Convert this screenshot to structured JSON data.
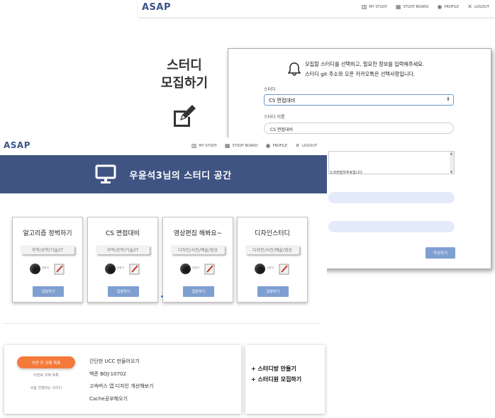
{
  "brand": "ASAP",
  "nav": {
    "my_study": "MY STUDY",
    "study_board": "STUDY BOARD",
    "profile": "PROFILE",
    "logout": "LOGOUT"
  },
  "recruit": {
    "title": "스터디\n모집하기",
    "message_line1": "모집할 스터디를 선택하고, 필요한 정보를 입력해주세요.",
    "message_line2": "스터디 git 주소와 오픈 카카오톡은 선택사항입니다.",
    "study_label": "스터디",
    "study_selected": "CS 면접대비",
    "name_label": "스터디 이름",
    "name_value": "CS 면접대비",
    "textarea_snippet": "드와면접위주로합니다",
    "submit_label": "작성하기"
  },
  "banner": {
    "title": "우윤석3님의 스터디 공간"
  },
  "studies": [
    {
      "name": "알고리즘 정벅하기",
      "tags": "과학/공학/기술/IT",
      "join_label": "입장하기"
    },
    {
      "name": "CS 면접대비",
      "tags": "과학/공학/기술/IT",
      "join_label": "입장하기"
    },
    {
      "name": "영상편집 해봐요~",
      "tags": "디자인/사진/예술/영상",
      "join_label": "입장하기"
    },
    {
      "name": "디자인스터디",
      "tags": "디자인/사진/예술/영상",
      "join_label": "입장하기"
    }
  ],
  "avatar_caption": "우윤석",
  "tasks_panel": {
    "tab_active": "이번 주 과제 목록",
    "tab_2": "이번로 과제 목록",
    "tab_3": "오늘 진행되는 스터디",
    "items": [
      "간단한 UCC 만들어오기",
      "백준 BOJ-10702",
      "고속버스 앱 디자인 개선해보기",
      "Cache공부해오기"
    ]
  },
  "actions": {
    "make_room": "+ 스터디방 만들기",
    "recruit_members": "+ 스터디원 모집하기"
  },
  "colors": {
    "brand": "#3b5488",
    "banner": "#3f5482",
    "button": "#7f9fd1",
    "accent": "#f47a3c"
  }
}
